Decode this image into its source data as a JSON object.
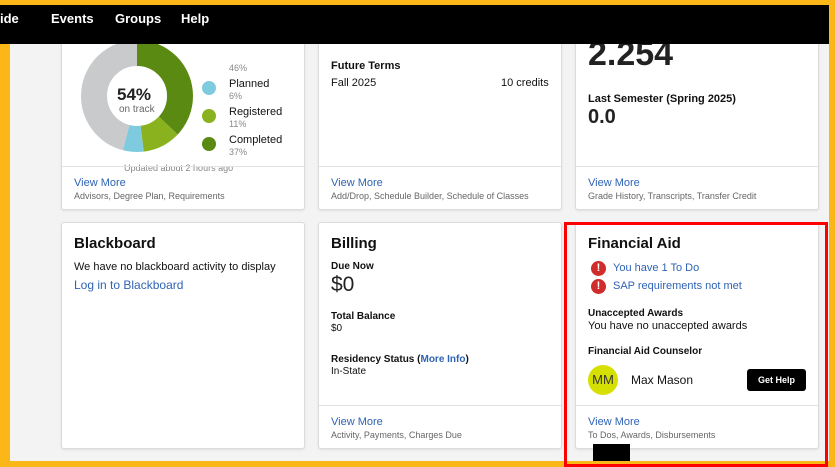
{
  "nav": {
    "items": [
      "ide",
      "Events",
      "Groups",
      "Help"
    ]
  },
  "colors": {
    "page_border": "#fbb617",
    "link": "#2f63b5",
    "error": "#d12c2c",
    "avatar_bg": "#d6e000",
    "planned": "#7ecbe0",
    "registered": "#8ab21e",
    "completed": "#5a8a12"
  },
  "degree_progress": {
    "percent": "54%",
    "percent_value": 54,
    "caption": "on track",
    "legend": [
      {
        "label": "",
        "pct": "46%",
        "value": 46,
        "color": "#c9cacc"
      },
      {
        "label": "Planned",
        "pct": "6%",
        "value": 6,
        "color": "#7ecbe0"
      },
      {
        "label": "Registered",
        "pct": "11%",
        "value": 11,
        "color": "#8ab21e"
      },
      {
        "label": "Completed",
        "pct": "37%",
        "value": 37,
        "color": "#5a8a12"
      }
    ],
    "updated": "Updated about 2 hours ago",
    "view_more": "View More",
    "view_more_sub": "Advisors, Degree Plan, Requirements"
  },
  "terms": {
    "future_label": "Future Terms",
    "term_name": "Fall 2025",
    "term_credits": "10 credits",
    "view_more": "View More",
    "view_more_sub": "Add/Drop, Schedule Builder, Schedule of Classes"
  },
  "gpa": {
    "cumulative": "2.254",
    "last_label": "Last Semester (Spring 2025)",
    "last_value": "0.0",
    "view_more": "View More",
    "view_more_sub": "Grade History, Transcripts, Transfer Credit"
  },
  "blackboard": {
    "title": "Blackboard",
    "message": "We have no blackboard activity to display",
    "login_link": "Log in to Blackboard"
  },
  "billing": {
    "title": "Billing",
    "due_label": "Due Now",
    "due_value": "$0",
    "total_label": "Total Balance",
    "total_value": "$0",
    "residency_label": "Residency Status (",
    "residency_link": "More Info",
    "residency_close": ")",
    "residency_value": "In-State",
    "view_more": "View More",
    "view_more_sub": "Activity, Payments, Charges Due"
  },
  "financial_aid": {
    "title": "Financial Aid",
    "todo_link": "You have 1 To Do",
    "sap_link": "SAP requirements not met",
    "unaccepted_label": "Unaccepted Awards",
    "unaccepted_text": "You have no unaccepted awards",
    "counselor_label": "Financial Aid Counselor",
    "counselor_initials": "MM",
    "counselor_name": "Max Mason",
    "help_button": "Get Help",
    "view_more": "View More",
    "view_more_sub": "To Dos, Awards, Disbursements"
  }
}
